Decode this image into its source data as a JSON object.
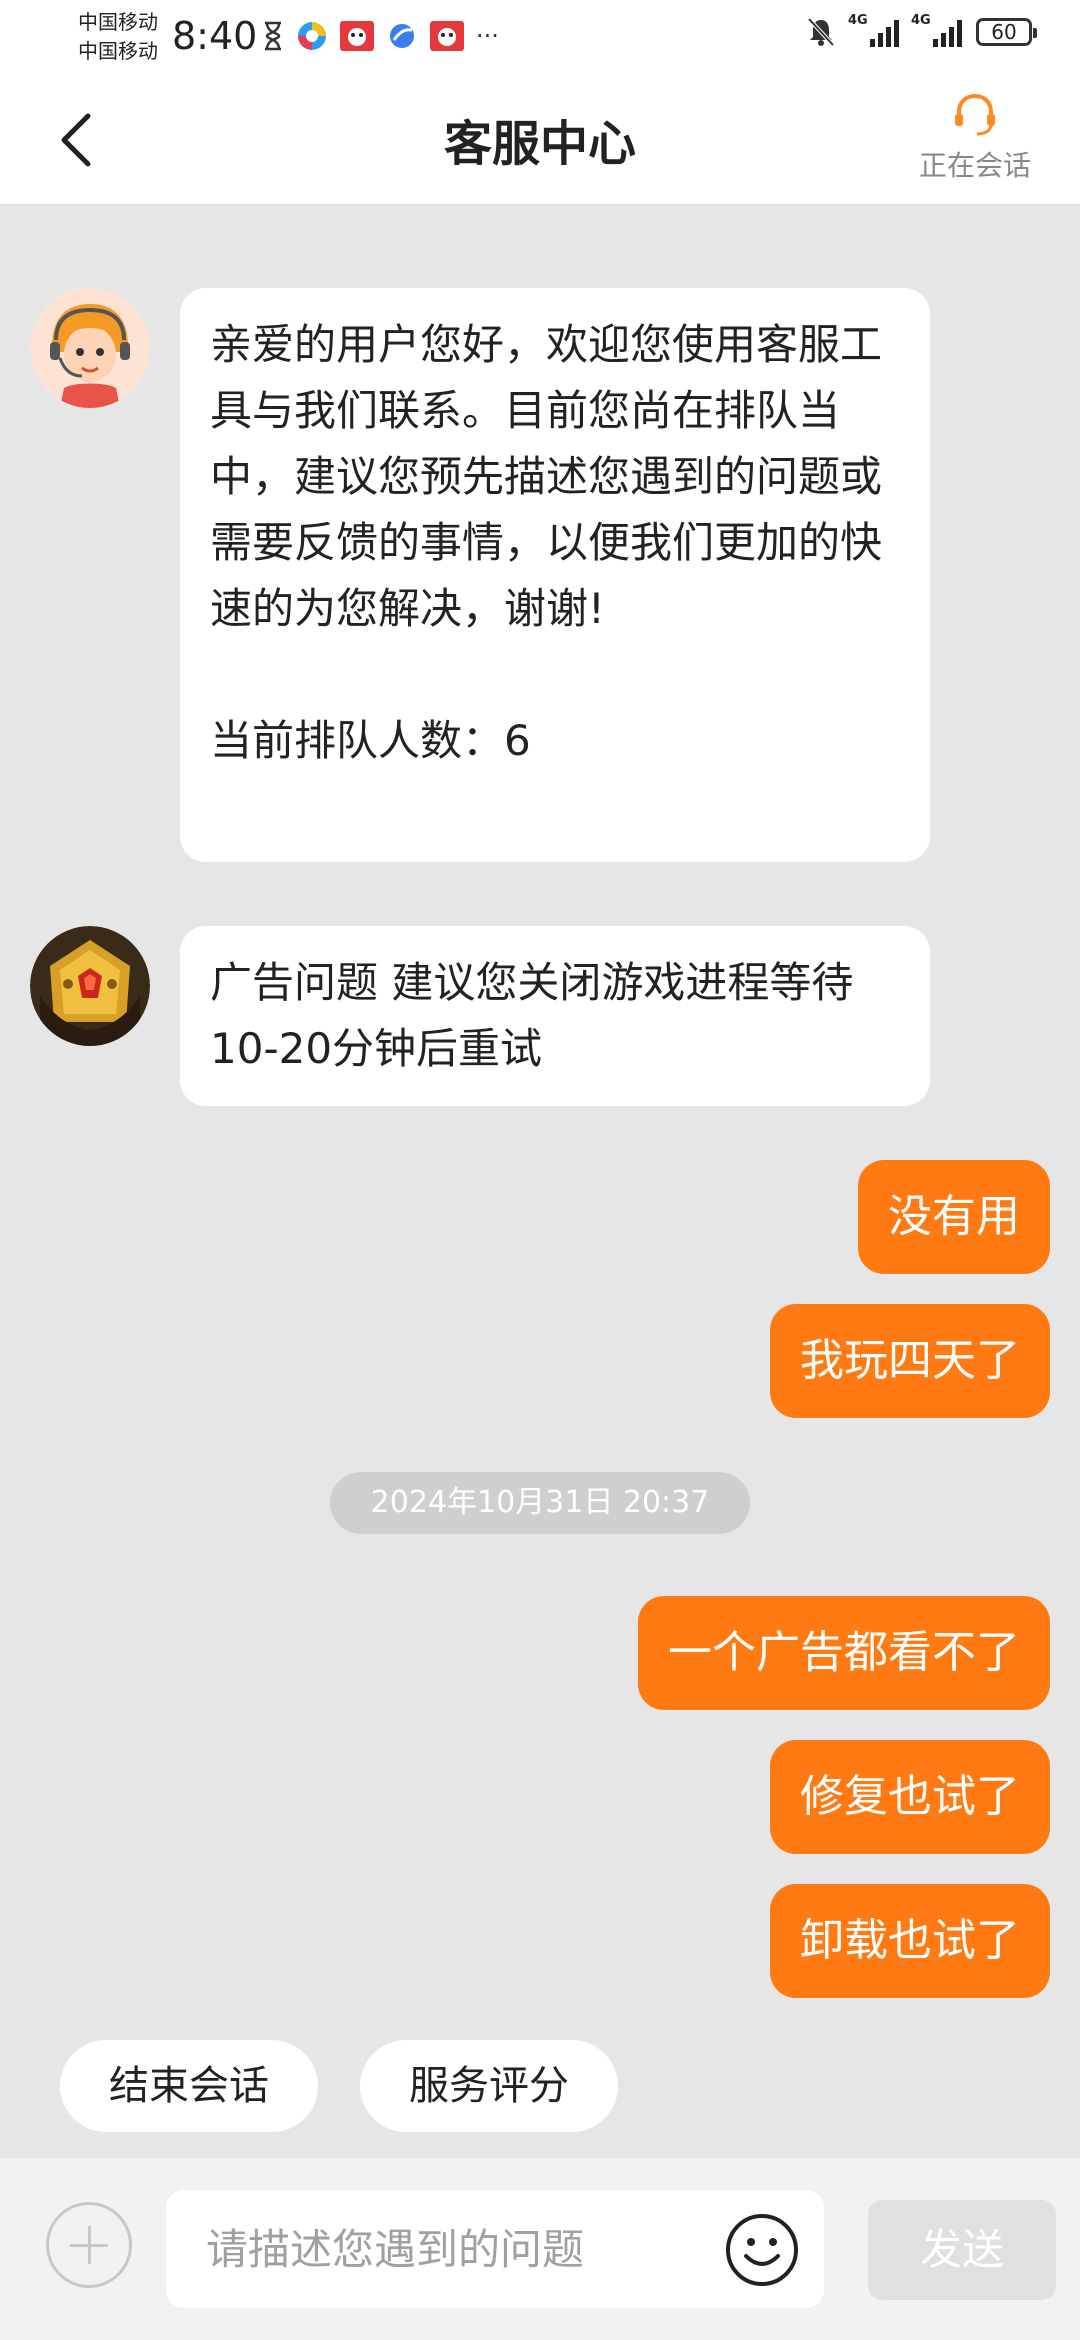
{
  "status_bar": {
    "carrier_1": "中国移动",
    "carrier_2": "中国移动",
    "time": "8:40",
    "network_1": "4G",
    "network_2": "4G",
    "battery": "60",
    "more": "···"
  },
  "header": {
    "title": "客服中心",
    "status_label": "正在会话",
    "accent": "#ff7a12"
  },
  "messages": {
    "welcome_text": "亲爱的用户您好，欢迎您使用客服工具与我们联系。目前您尚在排队当中，建议您预先描述您遇到的问题或需要反馈的事情，以便我们更加的快速的为您解决，谢谢!",
    "queue_text": "当前排队人数：6",
    "agent_reply": "广告问题 建议您关闭游戏进程等待10-20分钟后重试",
    "user_1": "没有用",
    "user_2": "我玩四天了",
    "timestamp": "2024年10月31日 20:37",
    "user_3": "一个广告都看不了",
    "user_4": "修复也试了",
    "user_5": "卸载也试了"
  },
  "quick_actions": {
    "end_session": "结束会话",
    "rate_service": "服务评分"
  },
  "input": {
    "placeholder": "请描述您遇到的问题",
    "value": "",
    "send_label": "发送"
  }
}
